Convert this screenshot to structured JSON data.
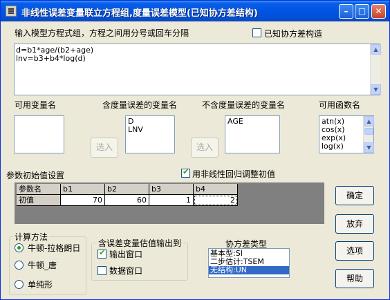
{
  "window": {
    "title": "非线性误差变量联立方程组,度量误差模型(已知协方差结构)"
  },
  "equations": {
    "label": "输入模型方程式组，方程之间用分号或回车分隔",
    "known_cov_label": "已知协方差构造",
    "known_cov_checked": false,
    "lines": [
      "d=b1*age/(b2+age)",
      "lnv=b3+b4*log(d)"
    ]
  },
  "variables": {
    "available_label": "可用变量名",
    "available_items": [],
    "with_error_label": "含度量误差的变量名",
    "with_error_items": [
      "D",
      "LNV"
    ],
    "select_label_1": "选入",
    "without_error_label": "不含度量误差的变量名",
    "without_error_items": [
      "AGE"
    ],
    "select_label_2": "选入",
    "functions_label": "可用函数名",
    "function_items": [
      "atn(x)",
      "cos(x)",
      "exp(x)",
      "log(x)"
    ]
  },
  "params": {
    "label": "参数初始值设置",
    "nonlinear_label": "用非线性回归调整初值",
    "nonlinear_checked": true,
    "row_header": "参数名",
    "row_label": "初值",
    "columns": [
      "b1",
      "b2",
      "b3",
      "b4"
    ],
    "values": [
      "70",
      "60",
      "1",
      "2"
    ]
  },
  "method": {
    "title": "计算方法",
    "options": [
      "牛顿-拉格朗日",
      "牛顿_唐",
      "单纯形"
    ],
    "selected_index": 0
  },
  "output": {
    "title": "含误差变量估值输出到",
    "output_window_label": "输出窗口",
    "output_window_checked": true,
    "data_window_label": "数据窗口",
    "data_window_checked": false
  },
  "cov_type": {
    "title": "协方差类型",
    "items": [
      "基本型:SI",
      "二步估计:TSEM",
      "无结构:UN"
    ],
    "selected_index": 2
  },
  "buttons": {
    "ok": "确定",
    "cancel": "放弃",
    "options": "选项",
    "help": "帮助"
  },
  "colors": {
    "titlebar": "#0054e3",
    "selection": "#316ac5",
    "face": "#ece9d8",
    "grid_bg": "#808080"
  },
  "icons": {
    "minimize": "minimize-icon",
    "maximize": "maximize-icon",
    "close": "close-icon",
    "app": "app-icon"
  }
}
